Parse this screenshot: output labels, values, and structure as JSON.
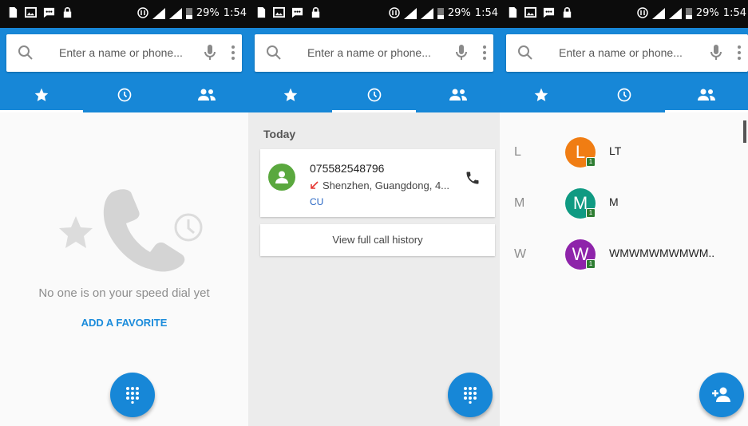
{
  "status_bar": {
    "battery": "29%",
    "time": "1:54"
  },
  "search": {
    "placeholder": "Enter a name or phone..."
  },
  "tabs": [
    "speed-dial",
    "recents",
    "contacts"
  ],
  "colors": {
    "primary": "#1787d7",
    "accent_text": "#1a8bdb",
    "missed_call": "#e53935"
  },
  "speed_dial": {
    "empty_text": "No one is on your speed dial yet",
    "add_label": "ADD A FAVORITE"
  },
  "recents": {
    "heading": "Today",
    "calls": [
      {
        "number": "075582548796",
        "location": "Shenzhen, Guangdong, 4...",
        "sim": "CU",
        "avatar_color": "#5aa83e",
        "call_type": "missed"
      }
    ],
    "history_label": "View full call history"
  },
  "contacts": {
    "items": [
      {
        "section": "L",
        "initial": "L",
        "name": "LT",
        "avatar_color": "#f07d13",
        "sim_badge": "1"
      },
      {
        "section": "M",
        "initial": "M",
        "name": "M",
        "avatar_color": "#0f9a82",
        "sim_badge": "1"
      },
      {
        "section": "W",
        "initial": "W",
        "name": "WMWMWMWMWM..",
        "avatar_color": "#8e24aa",
        "sim_badge": "1"
      }
    ]
  }
}
